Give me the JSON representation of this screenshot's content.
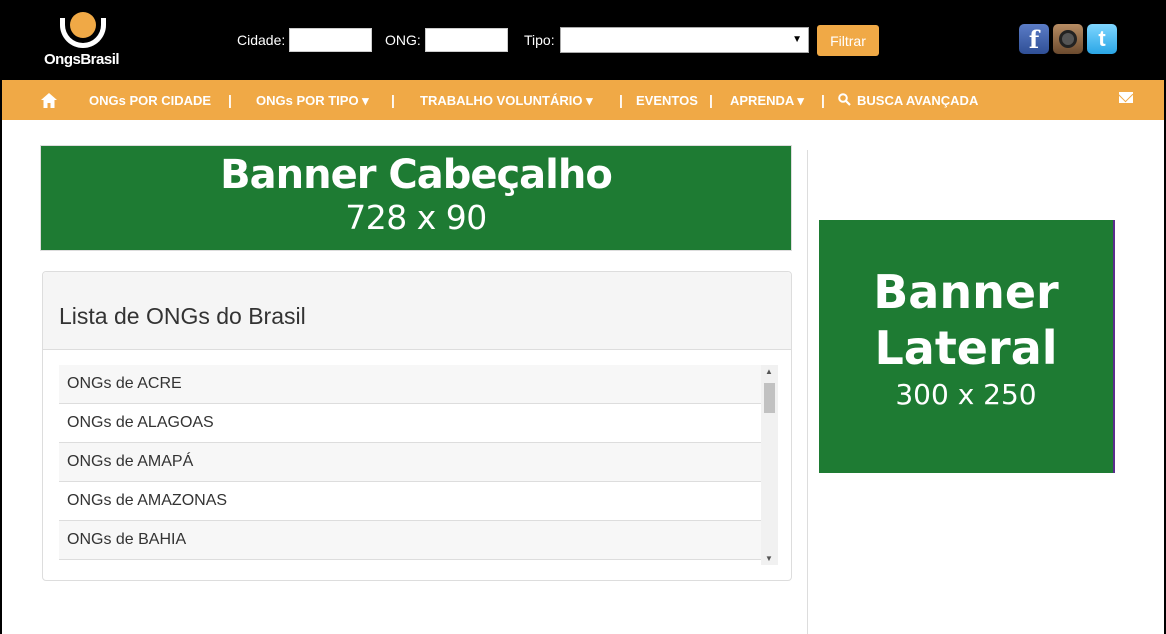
{
  "logo": {
    "text": "OngsBrasil"
  },
  "filters": {
    "cidade_label": "Cidade:",
    "cidade_value": "",
    "ong_label": "ONG:",
    "ong_value": "",
    "tipo_label": "Tipo:",
    "tipo_value": "",
    "filter_button": "Filtrar"
  },
  "social": [
    {
      "icon": "facebook-icon",
      "glyph": "f"
    },
    {
      "icon": "instagram-icon",
      "glyph": ""
    },
    {
      "icon": "twitter-icon",
      "glyph": "t"
    }
  ],
  "nav": {
    "items": [
      {
        "label": "ONGs POR CIDADE"
      },
      {
        "label": "ONGs POR TIPO ▾"
      },
      {
        "label": "TRABALHO VOLUNTÁRIO ▾"
      },
      {
        "label": "EVENTOS"
      },
      {
        "label": "APRENDA ▾"
      },
      {
        "label": "BUSCA AVANÇADA"
      }
    ],
    "separator": "|"
  },
  "banner_head": {
    "title": "Banner Cabeçalho",
    "size": "728 x 90"
  },
  "panel": {
    "title": "Lista de ONGs do Brasil",
    "items": [
      "ONGs de ACRE",
      "ONGs de ALAGOAS",
      "ONGs de AMAPÁ",
      "ONGs de AMAZONAS",
      "ONGs de BAHIA"
    ]
  },
  "banner_side": {
    "title_line1": "Banner",
    "title_line2": "Lateral",
    "size": "300 x 250"
  },
  "colors": {
    "orange": "#f0a946",
    "green": "#1e7b33",
    "black": "#000000"
  }
}
